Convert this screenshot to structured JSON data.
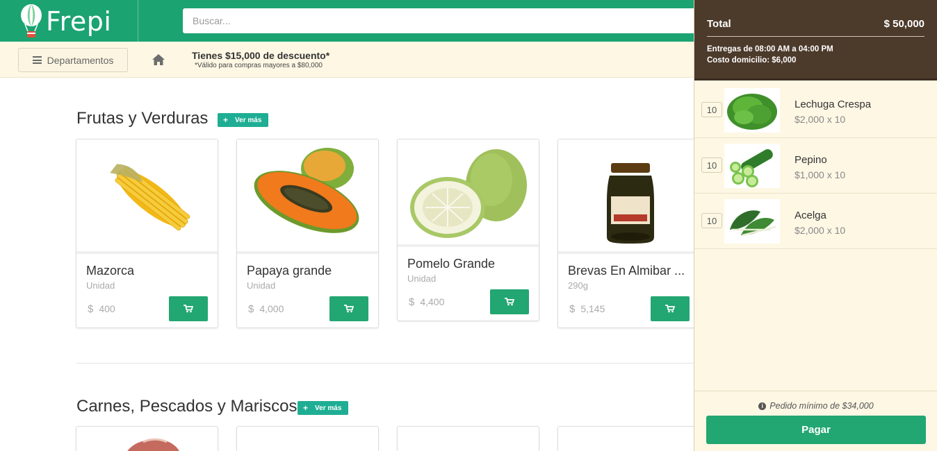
{
  "header": {
    "brand": "Frepi",
    "search_placeholder": "Buscar..."
  },
  "subbar": {
    "departments_label": "Departamentos",
    "promo_title": "Tienes $15,000 de descuento*",
    "promo_note": "*Válido para compras mayores a $80,000"
  },
  "sections": [
    {
      "title": "Frutas y Verduras",
      "more_label": "Ver más",
      "products": [
        {
          "name": "Mazorca",
          "unit": "Unidad",
          "currency": "$",
          "price": "400"
        },
        {
          "name": "Papaya grande",
          "unit": "Unidad",
          "currency": "$",
          "price": "4,000"
        },
        {
          "name": "Pomelo Grande",
          "unit": "Unidad",
          "currency": "$",
          "price": "4,400"
        },
        {
          "name": "Brevas En Almibar ...",
          "unit": "290g",
          "currency": "$",
          "price": "5,145"
        }
      ]
    },
    {
      "title": "Carnes, Pescados y Mariscos",
      "more_label": "Ver más"
    }
  ],
  "cart": {
    "total_label": "Total",
    "total_amount": "$ 50,000",
    "delivery_hours": "Entregas de 08:00 AM a 04:00 PM",
    "delivery_cost": "Costo domicilio: $6,000",
    "items": [
      {
        "qty": "10",
        "name": "Lechuga Crespa",
        "price": "$2,000 x 10"
      },
      {
        "qty": "10",
        "name": "Pepino",
        "price": "$1,000 x 10"
      },
      {
        "qty": "10",
        "name": "Acelga",
        "price": "$2,000 x 10"
      }
    ],
    "min_order": "Pedido mínimo de $34,000",
    "pay_label": "Pagar"
  },
  "colors": {
    "brand_green": "#1ba371",
    "button_green": "#22a672",
    "ver_mas_teal": "#1fae94",
    "cart_header_brown": "#4c3a2b",
    "cream": "#fdf7e4"
  }
}
